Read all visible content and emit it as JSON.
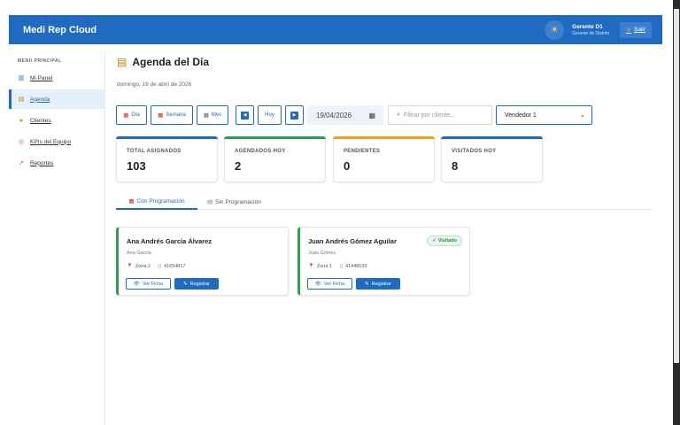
{
  "header": {
    "brand": "Medi Rep Cloud",
    "theme_icon": "sun-icon",
    "user_name": "Gerente D1",
    "user_role": "Gerente de Distrito",
    "logout_label": "Salir"
  },
  "sidebar": {
    "title": "MENÚ PRINCIPAL",
    "items": [
      {
        "label": "Mi Panel",
        "icon": "chart-icon"
      },
      {
        "label": "Agenda",
        "icon": "clipboard-icon",
        "active": true
      },
      {
        "label": "Clientes",
        "icon": "people-icon"
      },
      {
        "label": "KPIs del Equipo",
        "icon": "target-icon"
      },
      {
        "label": "Reportes",
        "icon": "trend-icon"
      }
    ]
  },
  "main": {
    "title": "Agenda del Día",
    "date_sub": "domingo, 19 de abril de 2026",
    "view_buttons": [
      "Día",
      "Semana",
      "Mes"
    ],
    "today_label": "Hoy",
    "date_value": "19/04/2026",
    "search_placeholder": "Filtrar por cliente...",
    "seller_selected": "Vendedor 1"
  },
  "stats": [
    {
      "label": "TOTAL ASIGNADOS",
      "value": "103",
      "color": "#1e6bc1"
    },
    {
      "label": "AGENDADOS HOY",
      "value": "2",
      "color": "#2e9e57"
    },
    {
      "label": "PENDIENTES",
      "value": "0",
      "color": "#f0a020"
    },
    {
      "label": "VISITADOS HOY",
      "value": "8",
      "color": "#1e6bc1"
    }
  ],
  "tabs": [
    {
      "label": "Con Programación",
      "active": true
    },
    {
      "label": "Sin Programación",
      "active": false
    }
  ],
  "cards": [
    {
      "name": "Ana Andrés García Álvarez",
      "contact": "Ana García",
      "zone": "Zona 2",
      "phone": "41654817",
      "ficha_label": "Ver Ficha",
      "register_label": "Registrar",
      "badge": null
    },
    {
      "name": "Juan Andrés Gómez Aguilar",
      "contact": "Juan Gómez",
      "zone": "Zona 1",
      "phone": "41448193",
      "ficha_label": "Ver Ficha",
      "register_label": "Registrar",
      "badge": "Visitado"
    }
  ]
}
